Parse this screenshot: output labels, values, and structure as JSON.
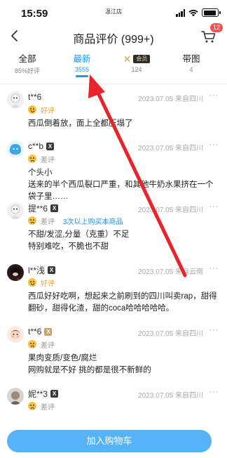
{
  "status_bar": {
    "time": "15:59",
    "carrier": "温江店",
    "battery_level": 0.9
  },
  "header": {
    "title": "商品评价 (999+)",
    "cart_badge": "12"
  },
  "tabs": [
    {
      "label": "全部",
      "sub": "85%好评"
    },
    {
      "label": "最新",
      "sub": "3555",
      "active": true
    },
    {
      "label": "会员",
      "sub": "124"
    },
    {
      "label": "带图",
      "sub": "4"
    }
  ],
  "reviews": [
    {
      "user": "t**6",
      "badge": "",
      "meta": "2023.07.05 来自四川",
      "rating": "好评",
      "rating_type": "good",
      "extra": "",
      "lines": [
        "西瓜倒着放，面上全都压塌了"
      ]
    },
    {
      "user": "c**b",
      "badge": "X",
      "meta": "2023.07.05 来自四川",
      "rating": "差评",
      "rating_type": "bad",
      "extra": "",
      "lines": [
        "个头小",
        "送来的半个西瓜裂口严重，和其他牛奶水果挤在一个袋子里……"
      ]
    },
    {
      "user": "提**6",
      "badge": "X",
      "meta": "2023.07.05 来自四川",
      "rating": "差评",
      "rating_type": "bad",
      "extra": "3次以上购买本商品",
      "lines": [
        "不甜/发涩,分量（克重）不足",
        "特别难吃，不脆也不甜"
      ]
    },
    {
      "user": "l**浅",
      "badge": "X",
      "meta": "2023.07.05 来自云南",
      "rating": "好评",
      "rating_type": "good",
      "extra": "",
      "lines": [
        "西瓜好好吃啊，想起来之前刷到的四川叫卖rap，甜得翻砂，甜得化渣，甜的coca哈哈哈哈哈。"
      ]
    },
    {
      "user": "t**6",
      "badge": "X",
      "badge_gold": true,
      "meta": "2023.07.05 来自四川",
      "rating": "差评",
      "rating_type": "bad",
      "extra": "",
      "lines": [
        "果肉变质/变色/腐烂",
        "网购就是不好 挑的都是很不新鲜的"
      ]
    },
    {
      "user": "妮**3",
      "badge": "X",
      "meta": "2023.07.05 来自四川",
      "rating": "差评",
      "rating_type": "bad",
      "extra": "",
      "lines": []
    }
  ],
  "bottom_button": "加入购物车",
  "icons": {
    "back": "chevron-left-icon",
    "cart": "cart-icon",
    "more": "more-dots-icon"
  },
  "colors": {
    "accent": "#1f97ee",
    "badge_red": "#f0524f",
    "button": "#56b3f7",
    "annotation_arrow": "#e8232a"
  },
  "more_glyph": "···"
}
